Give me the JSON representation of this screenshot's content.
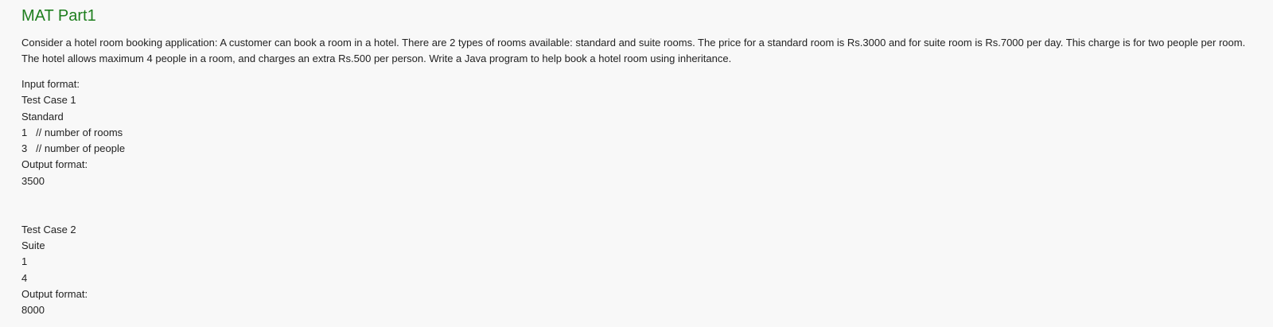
{
  "title": "MAT Part1",
  "description": "Consider a hotel room booking application: A customer can book a room in a hotel. There are 2 types of rooms available: standard and suite rooms. The price for a standard room is Rs.3000 and for suite room is Rs.7000 per day. This charge is for two people per room. The hotel allows maximum 4 people in a room, and charges an extra Rs.500 per person.  Write a Java program to help book a hotel room using inheritance.",
  "input_format_label": "Input format:",
  "test_case_1": {
    "label": "Test Case 1",
    "room_type": "Standard",
    "rooms_line": "1   // number of rooms",
    "people_line": "3   // number of people",
    "output_label": "Output format:",
    "output": "3500"
  },
  "test_case_2": {
    "label": "Test Case 2",
    "room_type": "Suite",
    "rooms_line": "1",
    "people_line": "4",
    "output_label": "Output format:",
    "output": "8000"
  },
  "colors": {
    "title": "#1e7e1e",
    "background": "#f8f8f8",
    "text": "#222222"
  }
}
